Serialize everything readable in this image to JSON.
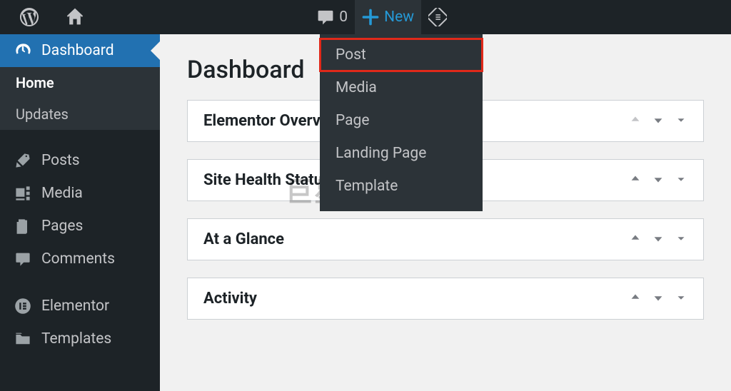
{
  "topbar": {
    "comment_count": "0",
    "new_label": "New"
  },
  "sidebar": {
    "items": [
      {
        "label": "Dashboard",
        "icon": "dashboard"
      },
      {
        "label": "Posts",
        "icon": "pin"
      },
      {
        "label": "Media",
        "icon": "media"
      },
      {
        "label": "Pages",
        "icon": "pages"
      },
      {
        "label": "Comments",
        "icon": "comment"
      },
      {
        "label": "Elementor",
        "icon": "elementor"
      },
      {
        "label": "Templates",
        "icon": "folder"
      }
    ],
    "sub_home": "Home",
    "sub_updates": "Updates"
  },
  "main": {
    "title": "Dashboard",
    "panels": [
      {
        "title": "Elementor Overview"
      },
      {
        "title": "Site Health Status"
      },
      {
        "title": "At a Glance"
      },
      {
        "title": "Activity"
      }
    ]
  },
  "dropdown": {
    "items": [
      "Post",
      "Media",
      "Page",
      "Landing Page",
      "Template"
    ]
  },
  "watermark": "巨星教程网"
}
